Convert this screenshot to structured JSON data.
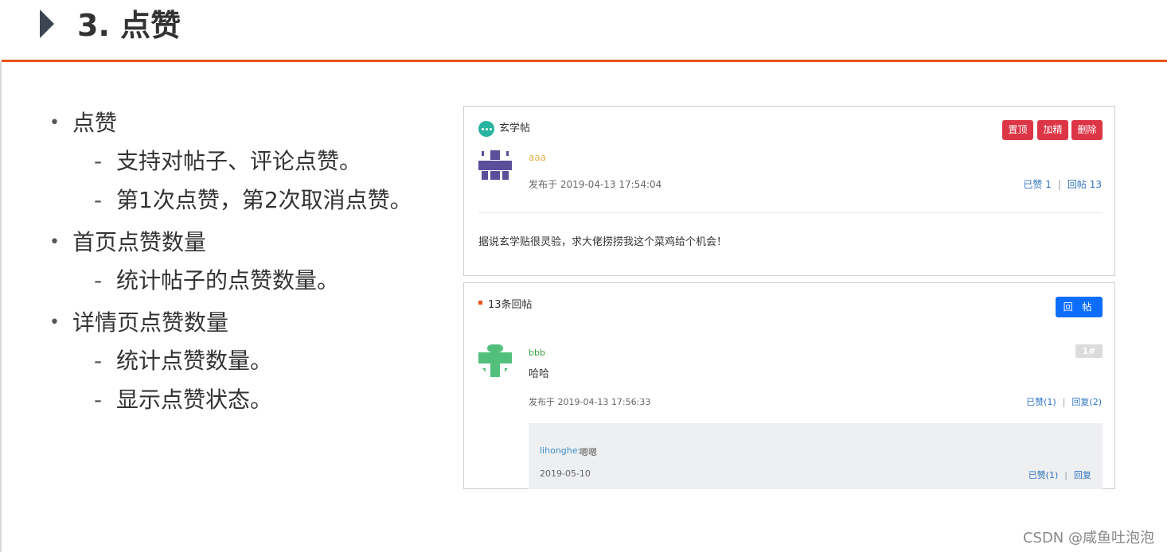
{
  "slide": {
    "title": "3. 点赞",
    "bullets": [
      {
        "label": "点赞",
        "subs": [
          "支持对帖子、评论点赞。",
          "第1次点赞，第2次取消点赞。"
        ]
      },
      {
        "label": "首页点赞数量",
        "subs": [
          "统计帖子的点赞数量。"
        ]
      },
      {
        "label": "详情页点赞数量",
        "subs": [
          "统计点赞数量。",
          "显示点赞状态。"
        ]
      }
    ]
  },
  "post": {
    "category": "玄学帖",
    "buttons": {
      "top": "置顶",
      "fine": "加精",
      "delete": "删除"
    },
    "author": "aaa",
    "published": "发布于 2019-04-13 17:54:04",
    "likes": "已赞 1",
    "replies": "回帖 13",
    "separator": "|",
    "body": "据说玄学贴很灵验，求大佬捞捞我这个菜鸡给个机会！"
  },
  "replies": {
    "header": "13条回帖",
    "reply_button": "回 帖",
    "item": {
      "author": "bbb",
      "floor": "1#",
      "text": "哈哈",
      "published": "发布于 2019-04-13 17:56:33",
      "likes": "已赞(1)",
      "reply_count": "回复(2)",
      "separator": "|",
      "sub_reply": {
        "user": "lihonghe:",
        "text": "嗯嗯",
        "date": "2019-05-10",
        "likes": "已赞(1)",
        "reply": "回复",
        "separator": "|"
      }
    }
  },
  "watermark": "CSDN @咸鱼吐泡泡",
  "colors": {
    "accent_rule": "#e8541a",
    "danger": "#dc3545",
    "primary": "#0d6efd",
    "link": "#2f74c0",
    "category_icon": "#27b4a0",
    "avatar_purple": "#5b4e9b",
    "avatar_green": "#52c07c"
  },
  "icons": [
    "chat-bubble-icon",
    "identicon-avatar-aaa",
    "identicon-avatar-bbb",
    "slide-arrow-icon"
  ]
}
